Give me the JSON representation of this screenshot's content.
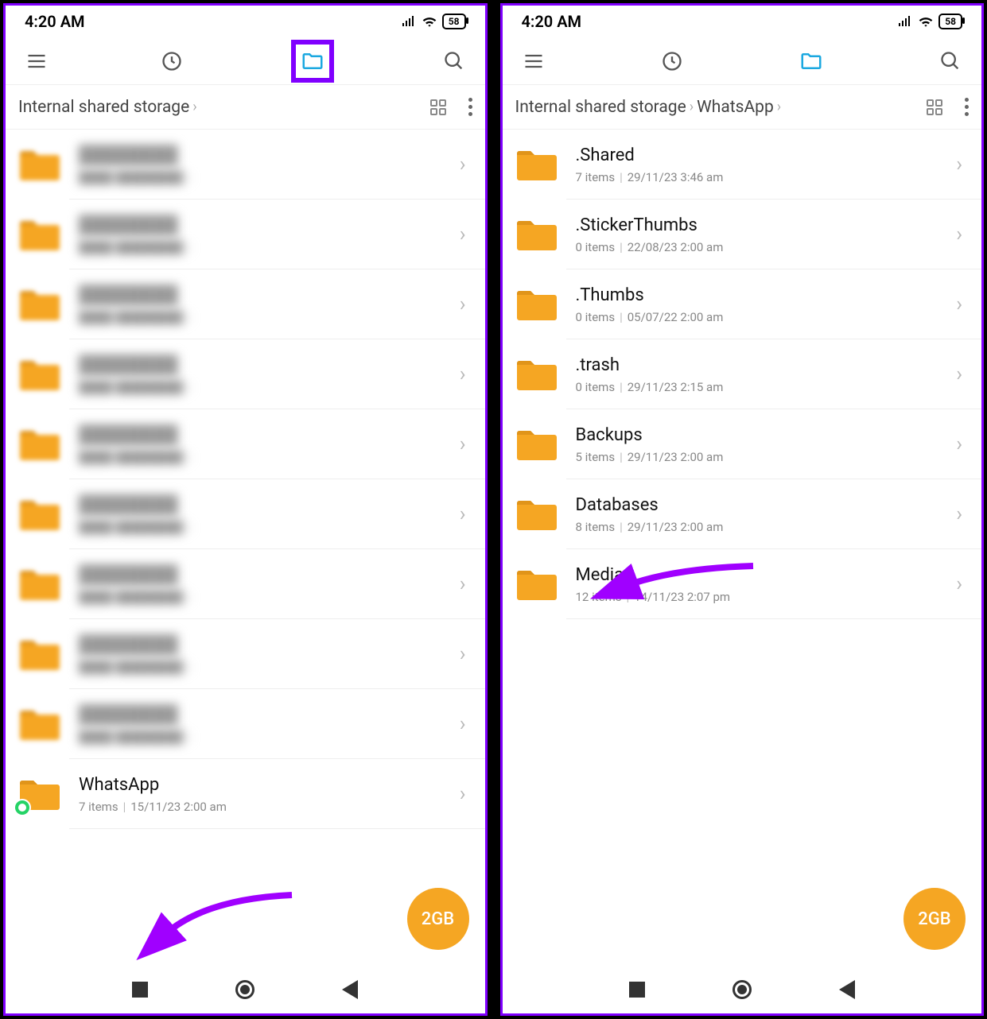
{
  "statusbar": {
    "time": "4:20 AM",
    "battery": "58"
  },
  "left": {
    "breadcrumbs": [
      "Internal shared storage"
    ],
    "blurred_count": 9,
    "whatsapp_row": {
      "title": "WhatsApp",
      "items": "7 items",
      "date": "15/11/23 2:00 am"
    },
    "fab": "2GB"
  },
  "right": {
    "breadcrumbs": [
      "Internal shared storage",
      "WhatsApp"
    ],
    "rows": [
      {
        "title": ".Shared",
        "items": "7 items",
        "date": "29/11/23 3:46 am"
      },
      {
        "title": ".StickerThumbs",
        "items": "0 items",
        "date": "22/08/23 2:00 am"
      },
      {
        "title": ".Thumbs",
        "items": "0 items",
        "date": "05/07/22 2:00 am"
      },
      {
        "title": ".trash",
        "items": "0 items",
        "date": "29/11/23 2:15 am"
      },
      {
        "title": "Backups",
        "items": "5 items",
        "date": "29/11/23 2:00 am"
      },
      {
        "title": "Databases",
        "items": "8 items",
        "date": "29/11/23 2:00 am"
      },
      {
        "title": "Media",
        "items": "12 items",
        "date": "14/11/23 2:07 pm"
      }
    ],
    "fab": "2GB"
  },
  "blur_placeholder": {
    "title": "████████",
    "meta": "████  ████████"
  }
}
